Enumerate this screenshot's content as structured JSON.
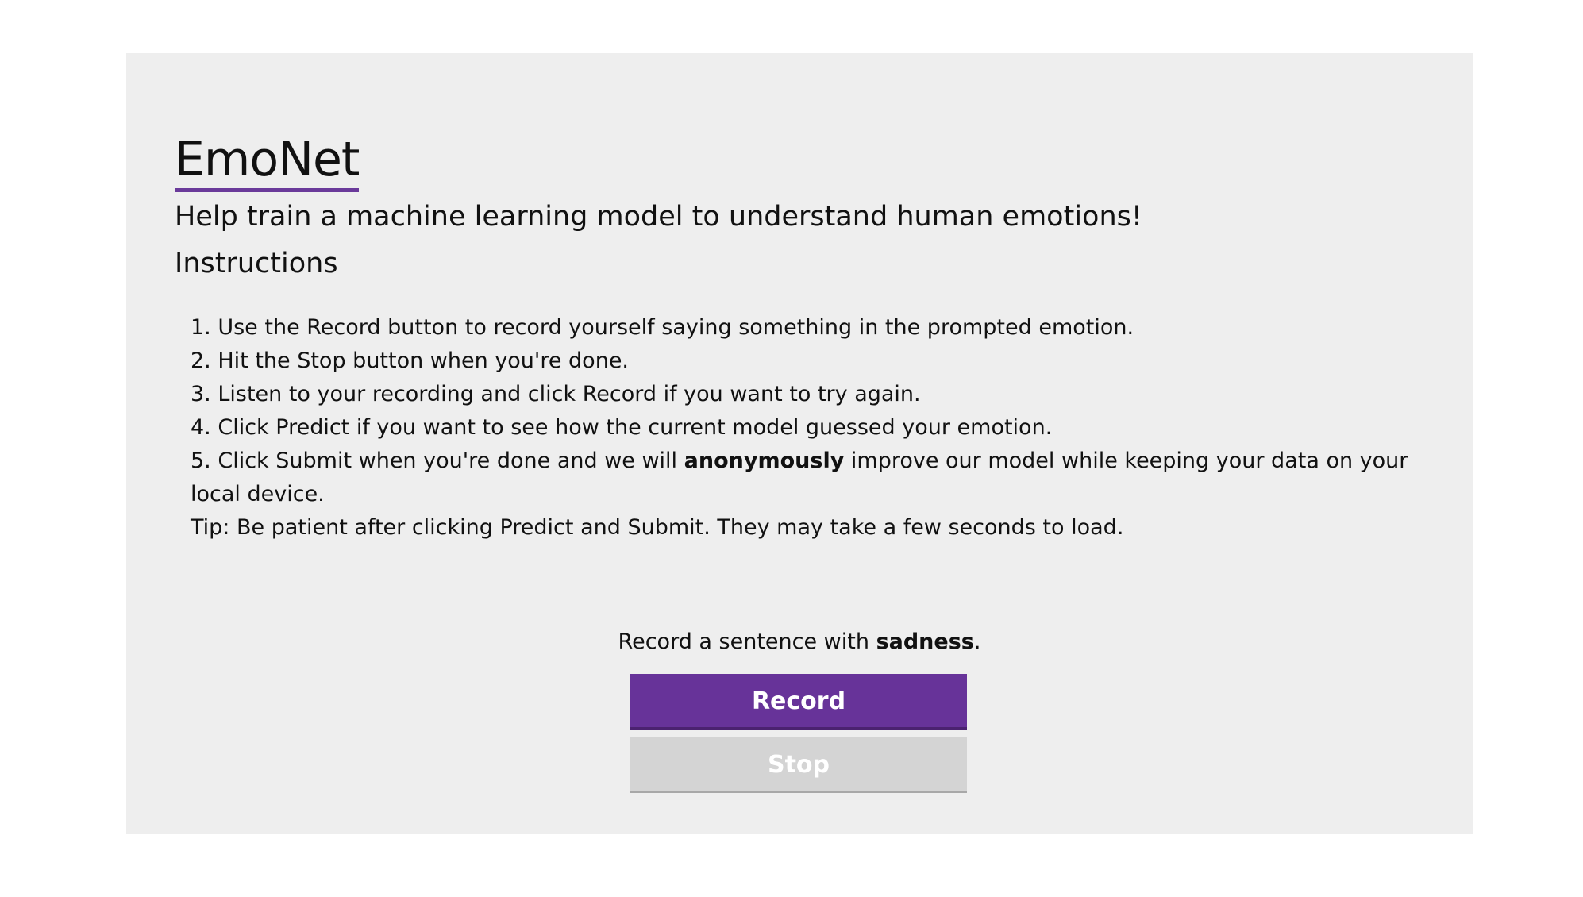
{
  "header": {
    "title": "EmoNet",
    "subtitle": "Help train a machine learning model to understand human emotions!",
    "instructions_heading": "Instructions"
  },
  "instructions": {
    "step1": "1. Use the Record button to record yourself saying something in the prompted emotion.",
    "step2": "2. Hit the Stop button when you're done.",
    "step3": "3. Listen to your recording and click Record if you want to try again.",
    "step4": "4. Click Predict if you want to see how the current model guessed your emotion.",
    "step5_before": "5. Click Submit when you're done and we will ",
    "step5_bold": "anonymously",
    "step5_after": " improve our model while keeping your data on your local device.",
    "tip": "Tip: Be patient after clicking Predict and Submit. They may take a few seconds to load."
  },
  "prompt": {
    "before": "Record a sentence with ",
    "emotion": "sadness",
    "after": "."
  },
  "buttons": {
    "record_label": "Record",
    "stop_label": "Stop"
  },
  "colors": {
    "accent": "#673399",
    "title_underline": "#6a3a9a",
    "panel_background": "#eeeeee",
    "disabled_button": "#d4d4d4"
  }
}
